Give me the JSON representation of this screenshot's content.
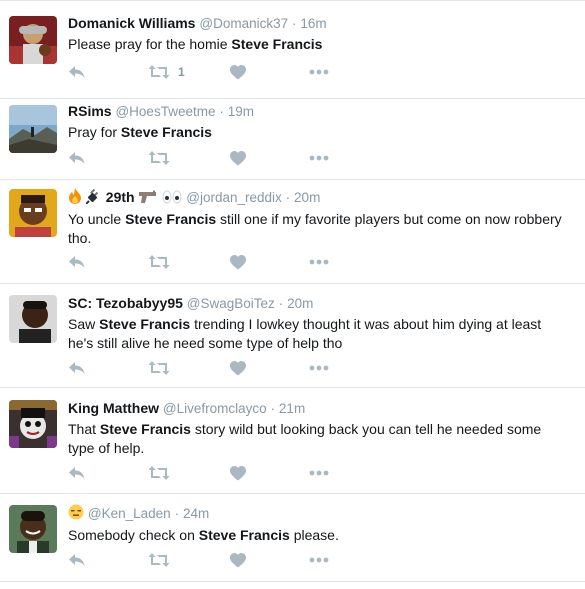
{
  "colors": {
    "action_icon": "#aab8c2",
    "muted": "#8899a6",
    "divider": "#e1e8ed"
  },
  "tweets": [
    {
      "name": "Domanick Williams",
      "handle": "@Domanick37",
      "dot": "·",
      "time": "16m",
      "text_before": "Please pray for the homie ",
      "highlight": "Steve Francis",
      "text_after": "",
      "retweet_count": "1",
      "avatar_icon": "avatar-football-player"
    },
    {
      "name": "RSims",
      "handle": "@HoesTweetme",
      "dot": "·",
      "time": "19m",
      "text_before": "Pray for ",
      "highlight": "Steve Francis",
      "text_after": "",
      "retweet_count": "",
      "avatar_icon": "avatar-mountain-landscape"
    },
    {
      "name": "29th",
      "name_prefix_emoji": "fire-icon plug-icon",
      "name_suffix_emoji": "gun-icon eyes-icon",
      "handle": "@jordan_reddix",
      "dot": "·",
      "time": "20m",
      "text_before": "Yo uncle ",
      "highlight": "Steve Francis",
      "text_after": " still one if my favorite players but come on now robbery tho.",
      "retweet_count": "",
      "avatar_icon": "avatar-person-yellow"
    },
    {
      "name": "SC: Tezobabyy95",
      "handle": "@SwagBoiTez",
      "dot": "·",
      "time": "20m",
      "text_before": "Saw ",
      "highlight": "Steve Francis",
      "text_after": " trending I lowkey thought it was about him dying at least he's still alive he need some type of help tho",
      "retweet_count": "",
      "avatar_icon": "avatar-person"
    },
    {
      "name": "King Matthew",
      "handle": "@Livefromclayco",
      "dot": "·",
      "time": "21m",
      "text_before": "That ",
      "highlight": "Steve Francis",
      "text_after": " story wild but looking back you can tell he needed some type of help.",
      "retweet_count": "",
      "avatar_icon": "avatar-painted-face"
    },
    {
      "name": "",
      "name_prefix_emoji": "expressionless-face-icon",
      "handle": "@Ken_Laden",
      "dot": "·",
      "time": "24m",
      "text_before": "Somebody check on ",
      "highlight": "Steve Francis",
      "text_after": " please.",
      "retweet_count": "",
      "avatar_icon": "avatar-smiling-man"
    }
  ]
}
